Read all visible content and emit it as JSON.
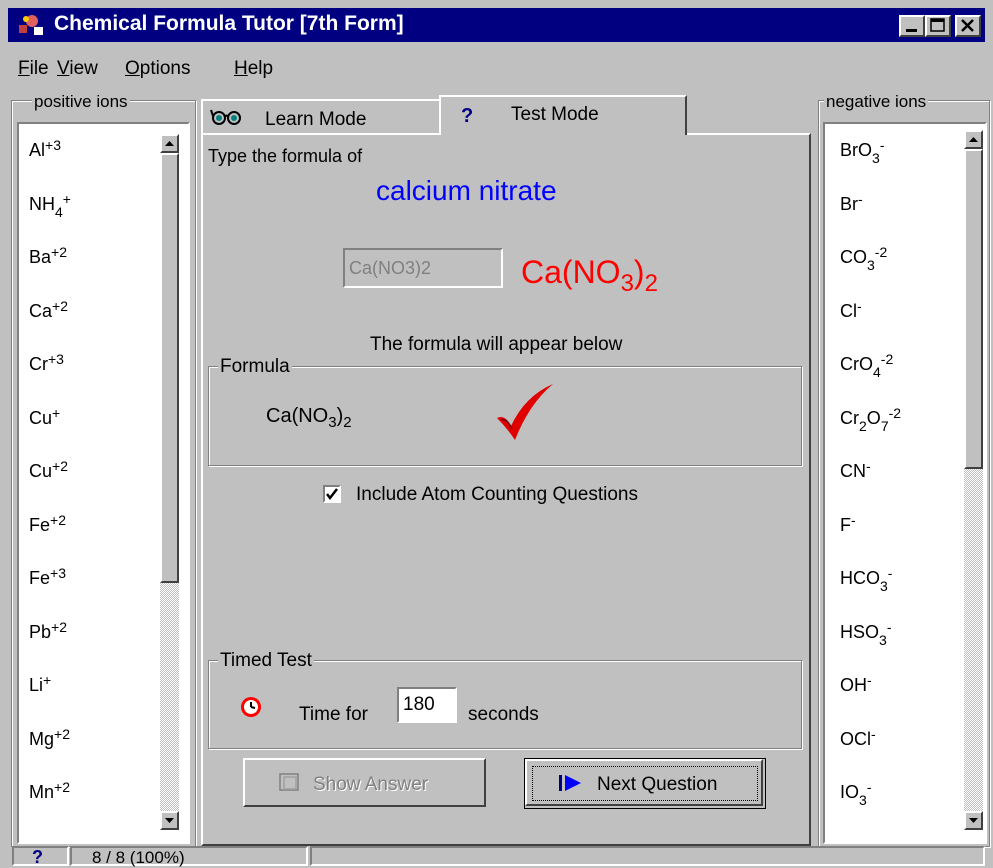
{
  "window": {
    "title": "Chemical Formula Tutor [7th Form]",
    "controls": [
      "minimize",
      "maximize",
      "close"
    ]
  },
  "menu": [
    {
      "label": "File",
      "underline": "F",
      "rest": "ile"
    },
    {
      "label": "View",
      "underline": "V",
      "rest": "iew"
    },
    {
      "label": "Options",
      "underline": "O",
      "rest": "ptions"
    },
    {
      "label": "Help",
      "underline": "H",
      "rest": "elp"
    }
  ],
  "positive_ions": {
    "legend": "positive ions",
    "items": [
      {
        "base": "Al",
        "charge": "+3"
      },
      {
        "base": "NH",
        "sub": "4",
        "charge": "+"
      },
      {
        "base": "Ba",
        "charge": "+2"
      },
      {
        "base": "Ca",
        "charge": "+2"
      },
      {
        "base": "Cr",
        "charge": "+3"
      },
      {
        "base": "Cu",
        "charge": "+"
      },
      {
        "base": "Cu",
        "charge": "+2"
      },
      {
        "base": "Fe",
        "charge": "+2"
      },
      {
        "base": "Fe",
        "charge": "+3"
      },
      {
        "base": "Pb",
        "charge": "+2"
      },
      {
        "base": "Li",
        "charge": "+"
      },
      {
        "base": "Mg",
        "charge": "+2"
      },
      {
        "base": "Mn",
        "charge": "+2"
      }
    ]
  },
  "negative_ions": {
    "legend": "negative ions",
    "items": [
      {
        "base": "BrO",
        "sub": "3",
        "charge": "-"
      },
      {
        "base": "Br",
        "charge": "-"
      },
      {
        "base": "CO",
        "sub": "3",
        "charge": "-2"
      },
      {
        "base": "Cl",
        "charge": "-"
      },
      {
        "base": "CrO",
        "sub": "4",
        "charge": "-2"
      },
      {
        "base": "Cr",
        "sub": "2",
        "base2": "O",
        "sub2": "7",
        "charge": "-2"
      },
      {
        "base": "CN",
        "charge": "-"
      },
      {
        "base": "F",
        "charge": "-"
      },
      {
        "base": "HCO",
        "sub": "3",
        "charge": "-"
      },
      {
        "base": "HSO",
        "sub": "3",
        "charge": "-"
      },
      {
        "base": "OH",
        "charge": "-"
      },
      {
        "base": "OCl",
        "charge": "-"
      },
      {
        "base": "IO",
        "sub": "3",
        "charge": "-"
      }
    ]
  },
  "tabs": {
    "learn": {
      "label": "Learn Mode",
      "icon": "glasses-icon"
    },
    "test": {
      "label": "Test Mode",
      "icon": "question-icon",
      "active": true
    }
  },
  "test_mode": {
    "prompt": "Type the formula of",
    "compound_name": "calcium nitrate",
    "answer_input_value": "Ca(NO3)2",
    "typed_formula": {
      "a": "Ca(NO",
      "s1": "3",
      "b": ")",
      "s2": "2"
    },
    "info_text": "The formula will appear below",
    "formula_group": {
      "legend": "Formula",
      "formula": {
        "a": "Ca(NO",
        "s1": "3",
        "b": ")",
        "s2": "2"
      },
      "result_icon": "checkmark-icon"
    },
    "include_atom_counting": {
      "label": "Include Atom Counting Questions",
      "checked": true
    },
    "timed_test": {
      "legend": "Timed Test",
      "icon": "stopwatch-icon",
      "time_for_label": "Time for",
      "seconds_value": "180",
      "seconds_label": "seconds"
    },
    "show_answer_button": {
      "label": "Show Answer",
      "enabled": false
    },
    "next_question_button": {
      "label": "Next Question",
      "enabled": true
    }
  },
  "status_bar": {
    "help_icon": "question-icon",
    "score": "8 / 8 (100%)"
  },
  "colors": {
    "title_bar": "#000080",
    "compound_name": "#0000ff",
    "typed_formula": "#ff0000",
    "checkmark": "#e00000"
  }
}
